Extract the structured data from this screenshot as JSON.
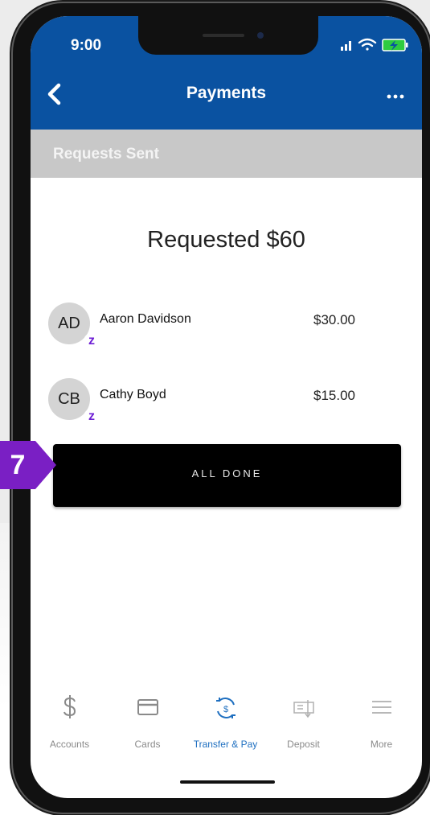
{
  "status": {
    "time": "9:00"
  },
  "header": {
    "title": "Payments"
  },
  "section": {
    "title": "Requests Sent"
  },
  "summary": {
    "text": "Requested $60"
  },
  "requests": [
    {
      "initials": "AD",
      "name": "Aaron Davidson",
      "amount": "$30.00",
      "badge": "z"
    },
    {
      "initials": "CB",
      "name": "Cathy Boyd",
      "amount": "$15.00",
      "badge": "z"
    }
  ],
  "done_button": {
    "label": "ALL DONE"
  },
  "tabs": [
    {
      "label": "Accounts",
      "icon": "dollar-icon",
      "active": false
    },
    {
      "label": "Cards",
      "icon": "card-icon",
      "active": false
    },
    {
      "label": "Transfer & Pay",
      "icon": "transfer-icon",
      "active": true
    },
    {
      "label": "Deposit",
      "icon": "check-deposit-icon",
      "active": false
    },
    {
      "label": "More",
      "icon": "menu-icon",
      "active": false
    }
  ],
  "callout": {
    "number": "7"
  },
  "colors": {
    "brand": "#0a52a1",
    "section_header": "#c8c8c8",
    "accent_active": "#1e6fc0",
    "zelle": "#6d1ed4",
    "callout": "#7a1fc4"
  }
}
